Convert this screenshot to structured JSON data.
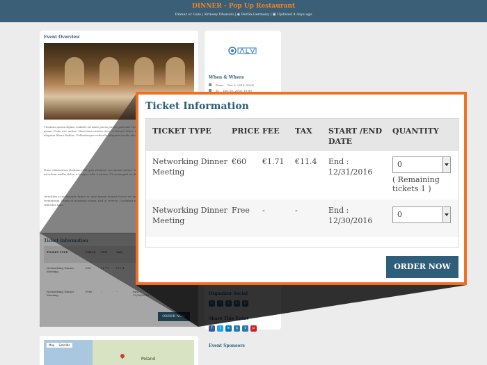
{
  "header": {
    "title": "DINNER - Pop Up Restaurant",
    "meta": "Dinner or Gala | Krinsey Dhanani | ◉ Berlin,Germany | ▣ Updated 4 days ago"
  },
  "event_overview": {
    "title": "Event Overview",
    "paragraphs": [
      "Vivamus massa ligula, sodales sit amet purus purus, pulvinar eget orci, lorem convallis interdum sed quam. Proin nec metus. Maecenas ornare risus et laoreet dolor. Duis vitae ullamcorper nibh. Maecenas aliquam libero finibus. Pellentesque vehicula Aliquam iaculis rhoncus.",
      "Nunc elementum rhoncus velit quis rhoncus. accumsan varius. Nunc ultricies ut est semper. Donec interdum mollis dolor, a tempor odio a auctor. Ut consequat ex diam, eu congue.",
      "Interdum et malesuada fames ac ante ipsum feugiat lectus vel sagittis viverra. Suspendisse facilisis fermentum. Etiam at maximus neque, nisl ut viverra. Curabitur nam in. Cras sociis magnis nascetur ridiculus mus."
    ]
  },
  "map": {
    "btn_map": "Map",
    "btn_satellite": "Satellite",
    "label": "Poland"
  },
  "when_where": {
    "title": "When & Where",
    "from_label": "From",
    "from_value": "Dec 9, 2016, 10:00",
    "to_label": "To",
    "to_value": "Dec 30, 2016, 19:00"
  },
  "organizer_social": {
    "title": "Organizer Social"
  },
  "share_event": {
    "title": "Share This Event"
  },
  "event_sponsors": {
    "title": "Event Sponsors"
  },
  "tickets": {
    "title": "Ticket Information",
    "columns": [
      "TICKET TYPE",
      "PRICE",
      "FEE",
      "TAX",
      "START /END DATE",
      "QUANTITY"
    ],
    "rows": [
      {
        "type": "Networking Dinner Meeting",
        "price": "€60",
        "fee": "€1.71",
        "tax": "€11.4",
        "date": "End : 12/31/2016",
        "quantity": "0",
        "remaining": "( Remaining tickets 1 )"
      },
      {
        "type": "Networking Dinner Meeting",
        "price": "Free",
        "fee": "-",
        "tax": "-",
        "date": "End : 12/30/2016",
        "quantity": "0",
        "remaining": ""
      }
    ],
    "order_label": "ORDER NOW"
  },
  "colors": {
    "accent": "#f26f21",
    "primary": "#2f5e7a",
    "header_bg": "#3b5f76"
  }
}
